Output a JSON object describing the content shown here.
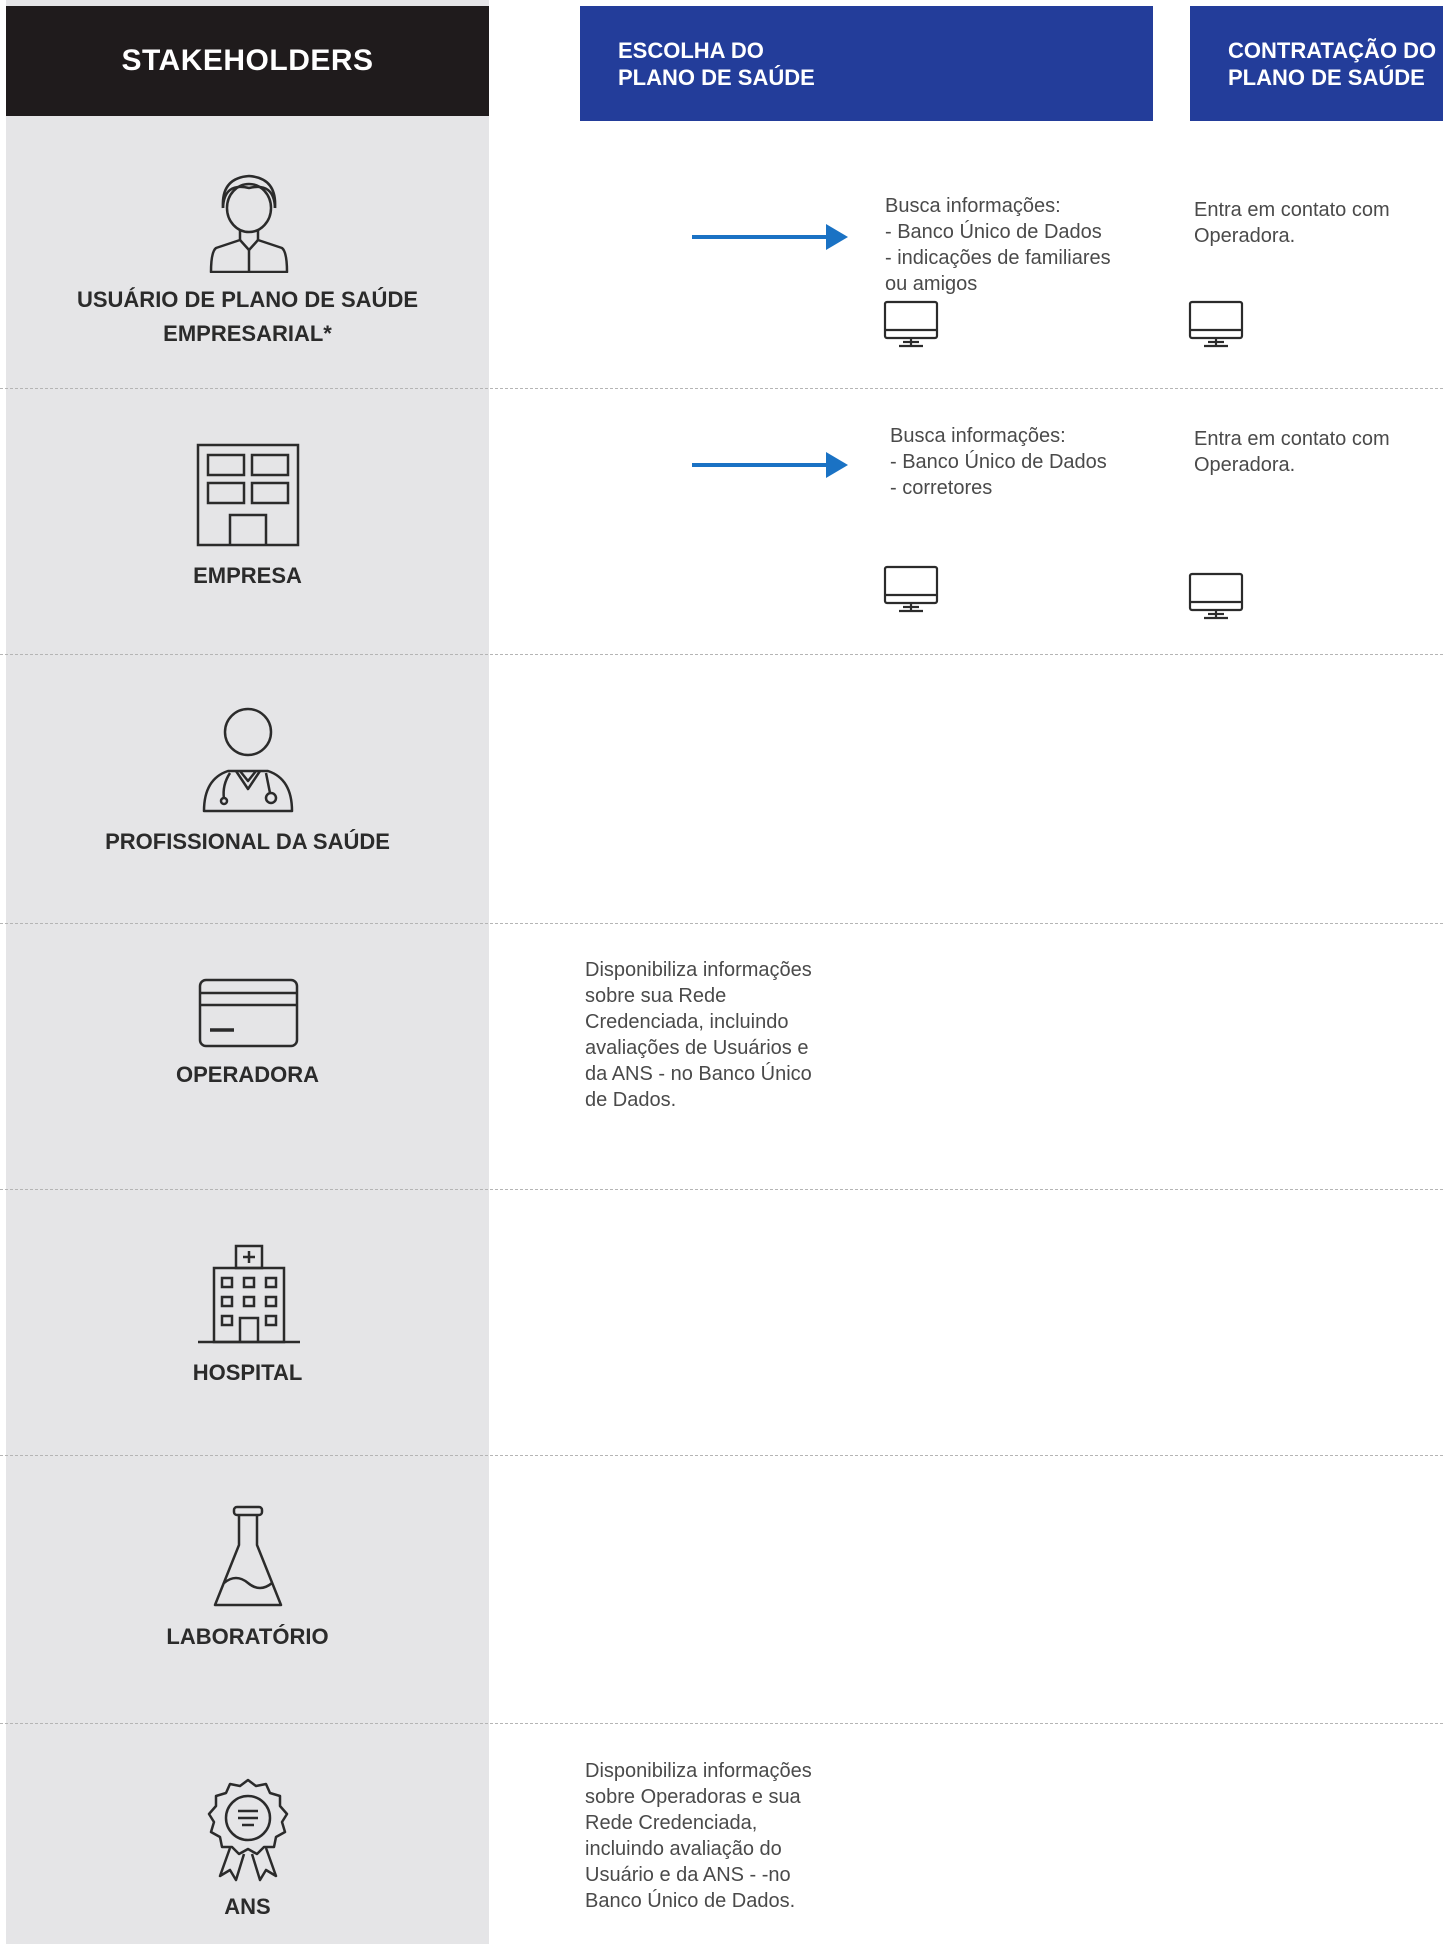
{
  "stakeholders_header": "STAKEHOLDERS",
  "columns": [
    {
      "line1": "ESCOLHA DO",
      "line2": "PLANO DE SAÚDE"
    },
    {
      "line1": "CONTRATAÇÃO DO",
      "line2": "PLANO DE SAÚDE"
    }
  ],
  "rows": {
    "usuario": {
      "label_line1": "USUÁRIO DE PLANO DE SAÚDE",
      "label_line2": "EMPRESARIAL*",
      "icon": "person-icon"
    },
    "empresa": {
      "label": "EMPRESA",
      "icon": "building-icon"
    },
    "profissional": {
      "label": "PROFISSIONAL DA SAÚDE",
      "icon": "doctor-icon"
    },
    "operadora": {
      "label": "OPERADORA",
      "icon": "card-icon"
    },
    "hospital": {
      "label": "HOSPITAL",
      "icon": "hospital-icon"
    },
    "laboratorio": {
      "label": "LABORATÓRIO",
      "icon": "flask-icon"
    },
    "ans": {
      "label": "ANS",
      "icon": "badge-icon"
    }
  },
  "notes": {
    "usuario_escolha": [
      "Busca informações:",
      "- Banco Único de Dados",
      "- indicações de familiares",
      "ou amigos"
    ],
    "usuario_contratacao": [
      "Entra em contato com",
      "Operadora."
    ],
    "empresa_escolha": [
      "Busca informações:",
      "- Banco Único de Dados",
      "- corretores"
    ],
    "empresa_contratacao": [
      "Entra em contato com",
      "Operadora."
    ],
    "operadora_escolha": [
      "Disponibiliza informações",
      "sobre sua Rede",
      "Credenciada, incluindo",
      "avaliações de Usuários e",
      "da ANS - no Banco Único",
      "de Dados."
    ],
    "ans_escolha": [
      "Disponibiliza informações",
      "sobre Operadoras e sua",
      "Rede Credenciada,",
      "incluindo avaliação do",
      "Usuário e da ANS - -no",
      "Banco Único de Dados."
    ]
  },
  "colors": {
    "header_dark": "#1f1b1c",
    "header_blue": "#233d9a",
    "sidebar": "#e5e5e7",
    "arrow": "#1a72c4"
  }
}
